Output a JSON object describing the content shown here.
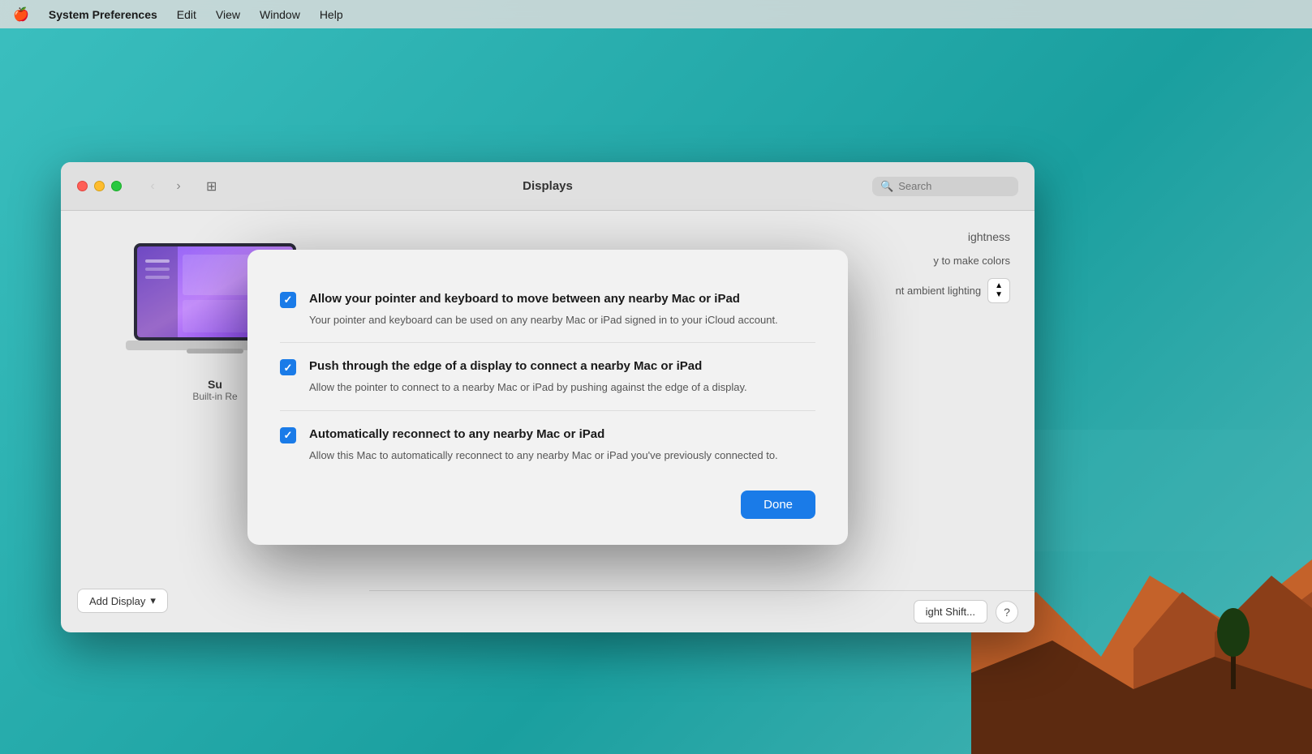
{
  "menubar": {
    "apple": "🍎",
    "app_name": "System Preferences",
    "items": [
      "Edit",
      "View",
      "Window",
      "Help"
    ]
  },
  "window": {
    "title": "Displays",
    "search_placeholder": "Search",
    "traffic_lights": {
      "close": "close",
      "minimize": "minimize",
      "maximize": "maximize"
    }
  },
  "display_panel": {
    "display_name": "Su",
    "display_sub": "Built-in Re",
    "add_display_label": "Add Display",
    "brightness_label": "ightness",
    "color_options": "y to make colors",
    "ambient_label": "nt ambient lighting",
    "night_shift_label": "ight Shift...",
    "help_label": "?"
  },
  "modal": {
    "items": [
      {
        "checked": true,
        "title": "Allow your pointer and keyboard to move between any nearby Mac or iPad",
        "description": "Your pointer and keyboard can be used on any nearby Mac or iPad signed in to your iCloud account."
      },
      {
        "checked": true,
        "title": "Push through the edge of a display to connect a nearby Mac or iPad",
        "description": "Allow the pointer to connect to a nearby Mac or iPad by pushing against the edge of a display."
      },
      {
        "checked": true,
        "title": "Automatically reconnect to any nearby Mac or iPad",
        "description": "Allow this Mac to automatically reconnect to any nearby Mac or iPad you've previously connected to."
      }
    ],
    "done_button_label": "Done"
  }
}
